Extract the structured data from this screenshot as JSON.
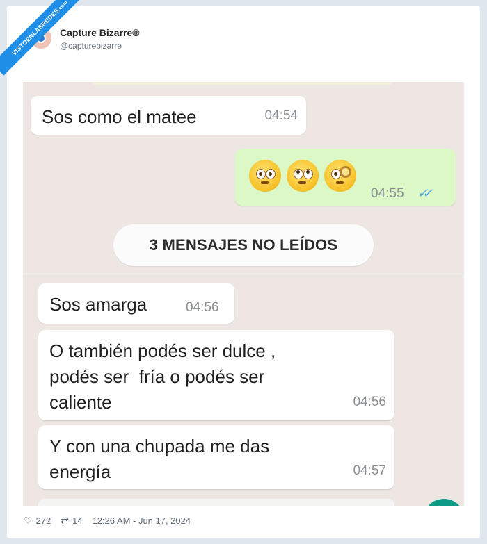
{
  "watermark": {
    "text": "VISTOENLASREDES",
    "sub": ".com"
  },
  "tweet": {
    "author_name": "Capture Bizarre®",
    "author_handle": "@capturebizarre",
    "likes": "272",
    "retweets": "14",
    "timestamp": "12:26 AM - Jun 17, 2024"
  },
  "chat": {
    "messages": [
      {
        "text": "Sos como el matee",
        "time": "04:54",
        "direction": "incoming"
      },
      {
        "emojis": [
          "flushed-face",
          "face-with-rolling-eyes",
          "face-with-monocle"
        ],
        "time": "04:55",
        "status": "read",
        "direction": "outgoing"
      },
      {
        "text": "Sos amarga",
        "time": "04:56",
        "direction": "incoming"
      },
      {
        "lines": [
          "O también podés ser dulce ,",
          "podés ser  fría o podés ser",
          "caliente"
        ],
        "time": "04:56",
        "direction": "incoming"
      },
      {
        "lines": [
          "Y con una chupada me das",
          "energía"
        ],
        "time": "04:57",
        "direction": "incoming"
      }
    ],
    "unread_banner": "3 MENSAJES NO LEÍDOS"
  },
  "colors": {
    "chat_background": "#ede6e2",
    "outgoing_bubble": "#dcf8c6",
    "incoming_bubble": "#ffffff",
    "read_ticks": "#4fa9e6",
    "fab": "#0e9b86",
    "watermark_ribbon": "#1e8ee6"
  }
}
